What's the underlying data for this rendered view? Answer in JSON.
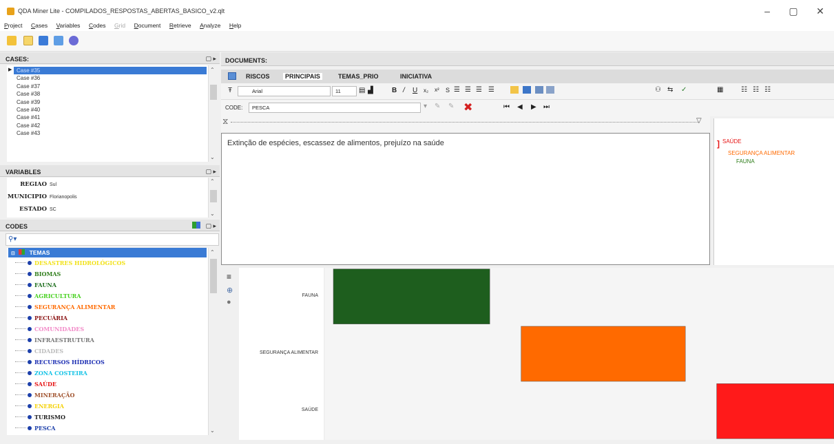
{
  "window": {
    "title": "QDA Miner Lite - COMPILADOS_RESPOSTAS_ABERTAS_BASICO_v2.qlt",
    "minimize": "–",
    "maximize": "▢",
    "close": "✕"
  },
  "menu": [
    "Project",
    "Cases",
    "Variables",
    "Codes",
    "Grid",
    "Document",
    "Retrieve",
    "Analyze",
    "Help"
  ],
  "cases": {
    "header": "CASES:",
    "items": [
      "Case #35",
      "Case #36",
      "Case #37",
      "Case #38",
      "Case #39",
      "Case #40",
      "Case #41",
      "Case #42",
      "Case #43"
    ]
  },
  "variables": {
    "header": "VARIABLES",
    "items": [
      {
        "name": "REGIAO",
        "value": "Sul"
      },
      {
        "name": "MUNICIPIO",
        "value": "Florianopolis"
      },
      {
        "name": "ESTADO",
        "value": "SC"
      }
    ]
  },
  "codes": {
    "header": "CODES",
    "root": "TEMAS",
    "items": [
      {
        "label": "DESASTRES HIDROLÓGICOS",
        "color": "#f2e21a"
      },
      {
        "label": "BIOMAS",
        "color": "#2e7d1a"
      },
      {
        "label": "FAUNA",
        "color": "#1f6f1f"
      },
      {
        "label": "AGRICULTURA",
        "color": "#47d11f"
      },
      {
        "label": "SEGURANÇA ALIMENTAR",
        "color": "#ff6a00"
      },
      {
        "label": "PECUÁRIA",
        "color": "#8b1414"
      },
      {
        "label": "COMUNIDADES",
        "color": "#f28cc8"
      },
      {
        "label": "INFRAESTRUTURA",
        "color": "#777777"
      },
      {
        "label": "CIDADES",
        "color": "#bbbbbb"
      },
      {
        "label": "RECURSOS HÍDRICOS",
        "color": "#1d2fb3"
      },
      {
        "label": "ZONA COSTEIRA",
        "color": "#14c3e6"
      },
      {
        "label": "SAÚDE",
        "color": "#e61414"
      },
      {
        "label": "MINERAÇÃO",
        "color": "#a0522d"
      },
      {
        "label": "ENERGIA",
        "color": "#f5d20a"
      },
      {
        "label": "TURISMO",
        "color": "#222222"
      },
      {
        "label": "PESCA",
        "color": "#1c3faa"
      }
    ]
  },
  "documents": {
    "header": "DOCUMENTS:",
    "tabs": [
      "RISCOS",
      "PRINCIPAIS",
      "TEMAS_PRIO",
      "INICIATIVA"
    ],
    "active_tab": "PRINCIPAIS",
    "font": "Arial",
    "font_size": "11",
    "code_label": "CODE:",
    "code_value": "PESCA",
    "text": "Extinção de espécies, escassez de alimentos, prejuízo na saúde",
    "margin_codes": [
      {
        "label": "SAÚDE",
        "color": "#e61414"
      },
      {
        "label": "SEGURANÇA ALIMENTAR",
        "color": "#ff6a00"
      },
      {
        "label": "FAUNA",
        "color": "#2e7d1a"
      }
    ]
  },
  "chart_data": {
    "type": "bar",
    "categories": [
      "FAUNA",
      "SEGURANÇA ALIMENTAR",
      "SAÚDE"
    ],
    "series": [
      {
        "category": "FAUNA",
        "start": 0,
        "end": 1,
        "color": "#1e5e1e"
      },
      {
        "category": "SEGURANÇA ALIMENTAR",
        "start": 1.2,
        "end": 2.25,
        "color": "#ff6a00"
      },
      {
        "category": "SAÚDE",
        "start": 2.45,
        "end": 3.2,
        "color": "#ff1a1a"
      }
    ],
    "xlim": [
      0,
      3.2
    ]
  }
}
